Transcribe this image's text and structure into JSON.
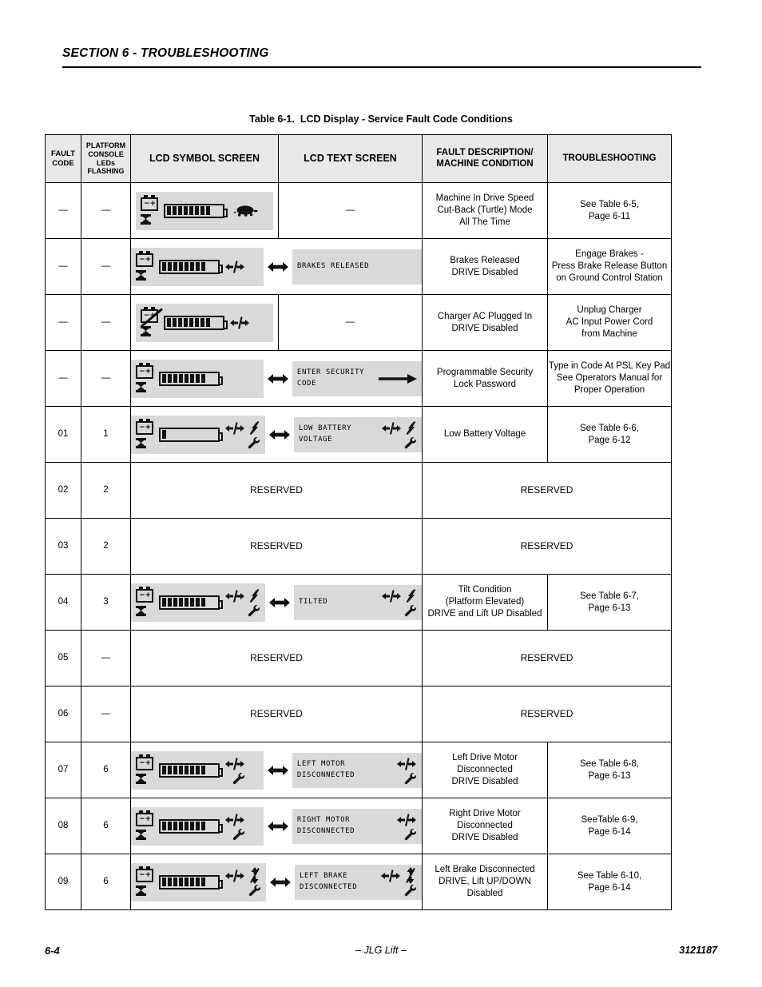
{
  "header": {
    "section_title": "SECTION 6 - TROUBLESHOOTING"
  },
  "table_caption": {
    "number": "Table 6-1.",
    "title": "LCD Display -  Service Fault Code Conditions"
  },
  "columns": [
    {
      "key": "fault_code",
      "label": "FAULT\nCODE"
    },
    {
      "key": "leds",
      "label": "PLATFORM\nCONSOLE\nLEDs\nFLASHING"
    },
    {
      "key": "symbol",
      "label": "LCD SYMBOL SCREEN"
    },
    {
      "key": "text",
      "label": "LCD TEXT SCREEN"
    },
    {
      "key": "description",
      "label": "FAULT DESCRIPTION/\nMACHINE CONDITION"
    },
    {
      "key": "troubleshooting",
      "label": "TROUBLESHOOTING"
    }
  ],
  "dash": "—",
  "reserved_label": "RESERVED",
  "rows": [
    {
      "fault_code": "—",
      "leds": "—",
      "symbol": {
        "battery_icon": "battery-icon",
        "battery_bars": 8,
        "extra_icons": [
          "turtle-icon"
        ],
        "hourglass": true
      },
      "text": null,
      "text_dash": "—",
      "description": "Machine In Drive Speed\nCut-Back (Turtle) Mode\nAll The Time",
      "troubleshooting": "See Table 6-5,\nPage 6-11"
    },
    {
      "fault_code": "—",
      "leds": "—",
      "symbol": {
        "battery_icon": "battery-icon",
        "battery_bars": 8,
        "extra_icons": [
          "drive-disabled-icon"
        ],
        "hourglass": true
      },
      "text": {
        "lines": "BRAKES RELEASED",
        "icons": []
      },
      "description": "Brakes Released\nDRIVE Disabled",
      "troubleshooting": "Engage Brakes -\nPress Brake Release Button\non Ground Control Station"
    },
    {
      "fault_code": "—",
      "leds": "—",
      "symbol": {
        "battery_icon": "battery-charger-unplug-icon",
        "battery_bars": 8,
        "extra_icons": [
          "drive-disabled-icon"
        ],
        "hourglass": true
      },
      "text": null,
      "text_dash": "—",
      "description": "Charger AC Plugged In\nDRIVE Disabled",
      "troubleshooting": "Unplug Charger\nAC Input Power Cord\nfrom Machine"
    },
    {
      "fault_code": "—",
      "leds": "—",
      "symbol": {
        "battery_icon": "battery-icon",
        "battery_bars": 8,
        "extra_icons": [],
        "hourglass": true
      },
      "text": {
        "lines": "ENTER SECURITY\nCODE",
        "icons": [
          "right-arrow-icon"
        ]
      },
      "description": "Programmable Security\nLock Password",
      "troubleshooting": "Type in Code At PSL Key Pad\nSee Operators Manual for\nProper Operation"
    },
    {
      "fault_code": "01",
      "leds": "1",
      "symbol": {
        "battery_icon": "battery-icon",
        "battery_bars": 1,
        "extra_icons": [
          "drive-disabled-icon",
          "lift-disabled-icon",
          "wrench-icon"
        ],
        "hourglass": true
      },
      "text": {
        "lines": "LOW BATTERY\nVOLTAGE",
        "icons": [
          "drive-disabled-icon",
          "lift-disabled-icon",
          "wrench-icon"
        ]
      },
      "description": "Low Battery Voltage",
      "troubleshooting": "See Table 6-6,\nPage 6-12"
    },
    {
      "fault_code": "02",
      "leds": "2",
      "reserved": true
    },
    {
      "fault_code": "03",
      "leds": "2",
      "reserved": true
    },
    {
      "fault_code": "04",
      "leds": "3",
      "symbol": {
        "battery_icon": "battery-icon",
        "battery_bars": 8,
        "extra_icons": [
          "drive-disabled-icon",
          "lift-disabled-icon",
          "wrench-icon"
        ],
        "hourglass": true
      },
      "text": {
        "lines": "TILTED",
        "icons": [
          "drive-disabled-icon",
          "lift-disabled-icon",
          "wrench-icon"
        ]
      },
      "description": "Tilt Condition\n(Platform Elevated)\nDRIVE and Lift UP Disabled",
      "troubleshooting": "See Table 6-7,\nPage 6-13"
    },
    {
      "fault_code": "05",
      "leds": "—",
      "reserved": true
    },
    {
      "fault_code": "06",
      "leds": "—",
      "reserved": true
    },
    {
      "fault_code": "07",
      "leds": "6",
      "symbol": {
        "battery_icon": "battery-icon",
        "battery_bars": 8,
        "extra_icons": [
          "drive-disabled-icon",
          "wrench-icon"
        ],
        "hourglass": true
      },
      "text": {
        "lines": "LEFT MOTOR\nDISCONNECTED",
        "icons": [
          "drive-disabled-icon",
          "wrench-icon"
        ]
      },
      "description": "Left Drive Motor\nDisconnected\nDRIVE Disabled",
      "troubleshooting": "See Table 6-8,\nPage 6-13"
    },
    {
      "fault_code": "08",
      "leds": "6",
      "symbol": {
        "battery_icon": "battery-icon",
        "battery_bars": 8,
        "extra_icons": [
          "drive-disabled-icon",
          "wrench-icon"
        ],
        "hourglass": true
      },
      "text": {
        "lines": "RIGHT MOTOR\nDISCONNECTED",
        "icons": [
          "drive-disabled-icon",
          "wrench-icon"
        ]
      },
      "description": "Right Drive Motor\nDisconnected\nDRIVE Disabled",
      "troubleshooting": "SeeTable 6-9,\nPage 6-14"
    },
    {
      "fault_code": "09",
      "leds": "6",
      "symbol": {
        "battery_icon": "battery-icon",
        "battery_bars": 8,
        "extra_icons": [
          "drive-disabled-icon",
          "lift-updown-disabled-icon",
          "wrench-icon"
        ],
        "hourglass": true
      },
      "text": {
        "lines": "LEFT BRAKE\nDISCONNECTED",
        "icons": [
          "drive-disabled-icon",
          "lift-updown-disabled-icon",
          "wrench-icon"
        ]
      },
      "description": "Left Brake Disconnected\nDRIVE, Lift UP/DOWN\nDisabled",
      "troubleshooting": "See Table 6-10,\nPage 6-14"
    }
  ],
  "footer": {
    "page_number": "6-4",
    "center": "– JLG Lift –",
    "doc_number": "3121187"
  }
}
